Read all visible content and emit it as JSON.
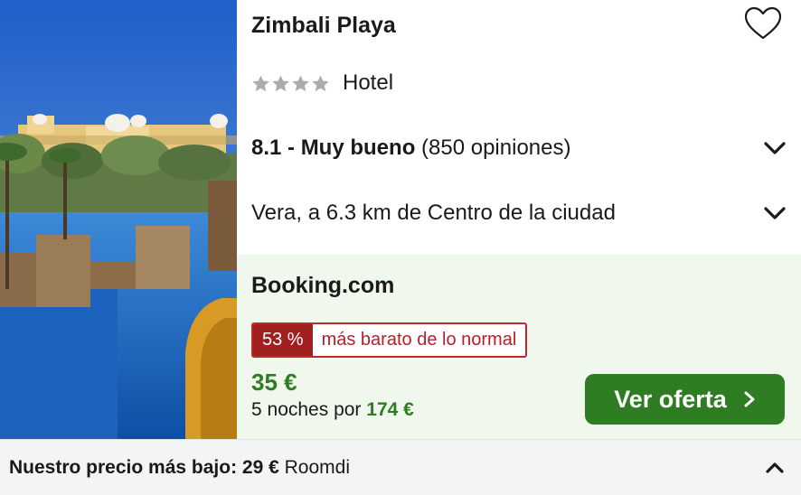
{
  "hotel": {
    "name": "Zimbali Playa",
    "stars": 4,
    "type": "Hotel",
    "rating_score": "8.1 - Muy bueno",
    "rating_reviews": "(850 opiniones)",
    "location": "Vera, a 6.3 km de Centro de la ciudad"
  },
  "offer": {
    "provider": "Booking.com",
    "discount_pct": "53 %",
    "discount_text": "más barato de lo normal",
    "price": "35 €",
    "nights_prefix": "5 noches por",
    "nights_total": "174 €",
    "cta_label": "Ver oferta"
  },
  "footer": {
    "label": "Nuestro precio más bajo:",
    "price": "29 €",
    "provider": "Roomdi"
  },
  "colors": {
    "accent_green": "#2e7d23",
    "deal_red": "#a0201f",
    "offer_bg": "#f0f7ec",
    "star_gray": "#a9adb0"
  },
  "icons": {
    "favorite": "heart-outline-icon",
    "rating_expand": "chevron-down-icon",
    "location_expand": "chevron-down-icon",
    "cta": "chevron-right-icon",
    "footer_toggle": "chevron-up-icon",
    "star": "star-icon"
  }
}
